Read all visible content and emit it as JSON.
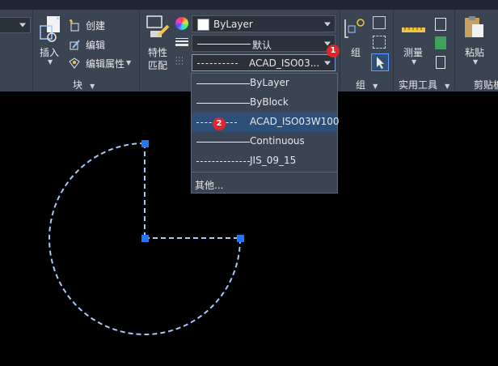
{
  "ribbon": {
    "block_panel": {
      "insert_label": "插入",
      "create_label": "创建",
      "edit_label": "编辑",
      "edit_attr_label": "编辑属性",
      "title": "块"
    },
    "properties_panel": {
      "match_label_1": "特性",
      "match_label_2": "匹配",
      "color_value": "ByLayer",
      "lineweight_value": "默认",
      "linetype_value": "ACAD_ISO03..."
    },
    "group_panel": {
      "group_label": "组",
      "title": "组"
    },
    "utilities_panel": {
      "measure_label": "测量",
      "title": "实用工具"
    },
    "clipboard_panel": {
      "paste_label": "粘贴",
      "title": "剪贴板"
    }
  },
  "linetype_dropdown": {
    "items": [
      {
        "label": "ByLayer",
        "selected": false
      },
      {
        "label": "ByBlock",
        "selected": false
      },
      {
        "label": "ACAD_ISO03W100",
        "selected": true
      },
      {
        "label": "Continuous",
        "selected": false
      },
      {
        "label": "JIS_09_15",
        "selected": false
      }
    ],
    "other_label": "其他..."
  },
  "badges": {
    "first": "1",
    "second": "2"
  },
  "colors": {
    "ribbon_bg": "#3b4453",
    "canvas_bg": "#000000",
    "selection": "#2d4f78",
    "grip": "#1e78ff",
    "badge": "#e0262c"
  }
}
